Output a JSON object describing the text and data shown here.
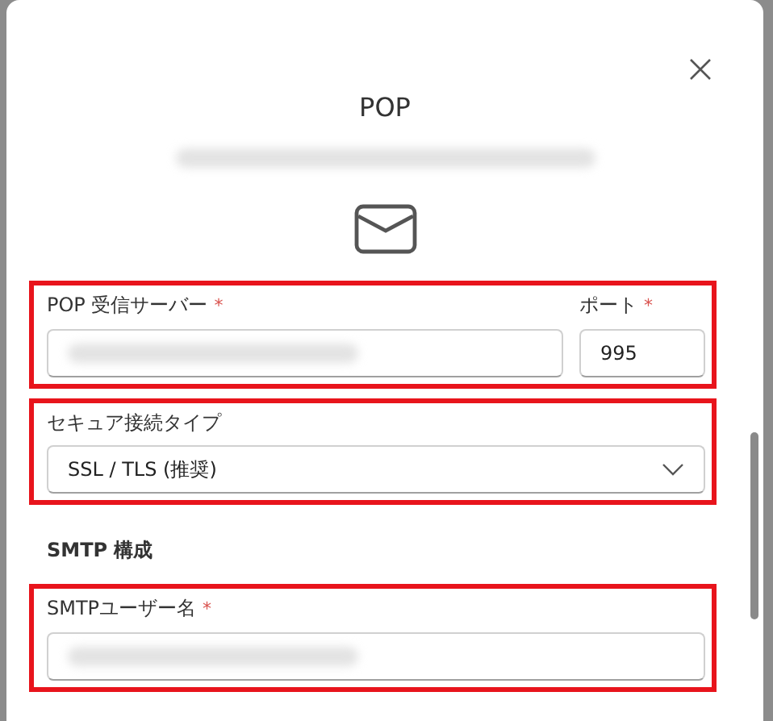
{
  "dialog": {
    "title": "POP",
    "subtitle_redacted": true
  },
  "sections": [
    {
      "kind": "row",
      "highlighted": true,
      "fields": [
        {
          "kind": "text",
          "label": "POP 受信サーバー",
          "required_mark": "*",
          "value_redacted": true
        },
        {
          "kind": "number",
          "label": "ポート",
          "required_mark": "*",
          "value": "995"
        }
      ]
    },
    {
      "kind": "row",
      "highlighted": true,
      "fields": [
        {
          "kind": "select",
          "label": "セキュア接続タイプ",
          "value": "SSL / TLS (推奨)"
        }
      ]
    },
    {
      "kind": "heading",
      "text": "SMTP 構成"
    },
    {
      "kind": "row",
      "highlighted": true,
      "fields": [
        {
          "kind": "text",
          "label": "SMTPユーザー名",
          "required_mark": "*",
          "value_redacted": true
        }
      ]
    }
  ]
}
